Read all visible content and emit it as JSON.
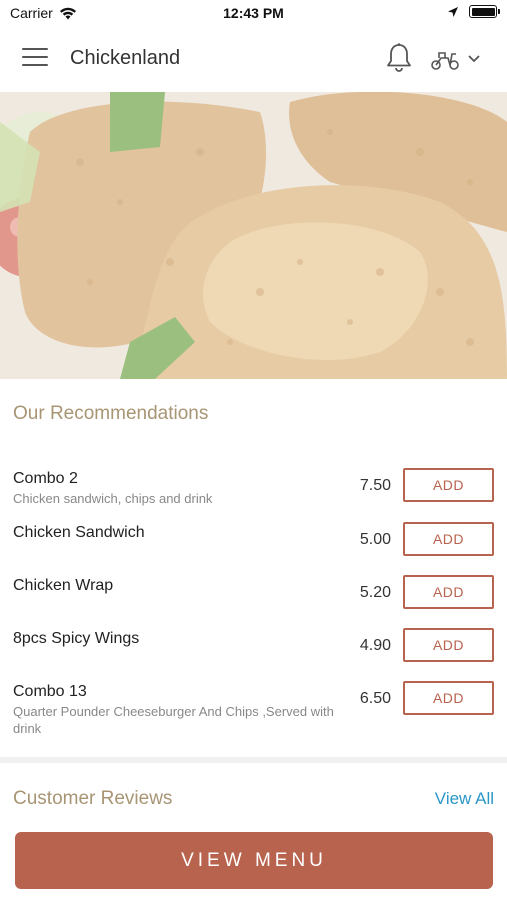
{
  "status_bar": {
    "carrier": "Carrier",
    "time": "12:43 PM"
  },
  "header": {
    "title": "Chickenland",
    "menu_icon": "hamburger-menu-icon",
    "notification_icon": "bell-icon",
    "delivery_icon": "scooter-icon",
    "dropdown_icon": "chevron-down-icon"
  },
  "hero": {
    "image": "fried-chicken-photo"
  },
  "recommendations": {
    "title": "Our Recommendations",
    "items": [
      {
        "name": "Combo 2",
        "description": "Chicken sandwich, chips and drink",
        "price": "7.50",
        "button": "ADD"
      },
      {
        "name": "Chicken Sandwich",
        "description": "",
        "price": "5.00",
        "button": "ADD"
      },
      {
        "name": "Chicken Wrap",
        "description": "",
        "price": "5.20",
        "button": "ADD"
      },
      {
        "name": "8pcs Spicy Wings",
        "description": "",
        "price": "4.90",
        "button": "ADD"
      },
      {
        "name": "Combo 13",
        "description": "Quarter Pounder Cheeseburger And Chips ,Served with drink",
        "price": "6.50",
        "button": "ADD"
      }
    ]
  },
  "reviews": {
    "title": "Customer Reviews",
    "view_all": "View All"
  },
  "footer": {
    "view_menu": "VIEW MENU"
  },
  "colors": {
    "accent": "#b8634e",
    "section_title": "#a89574",
    "link": "#2b96c9"
  }
}
